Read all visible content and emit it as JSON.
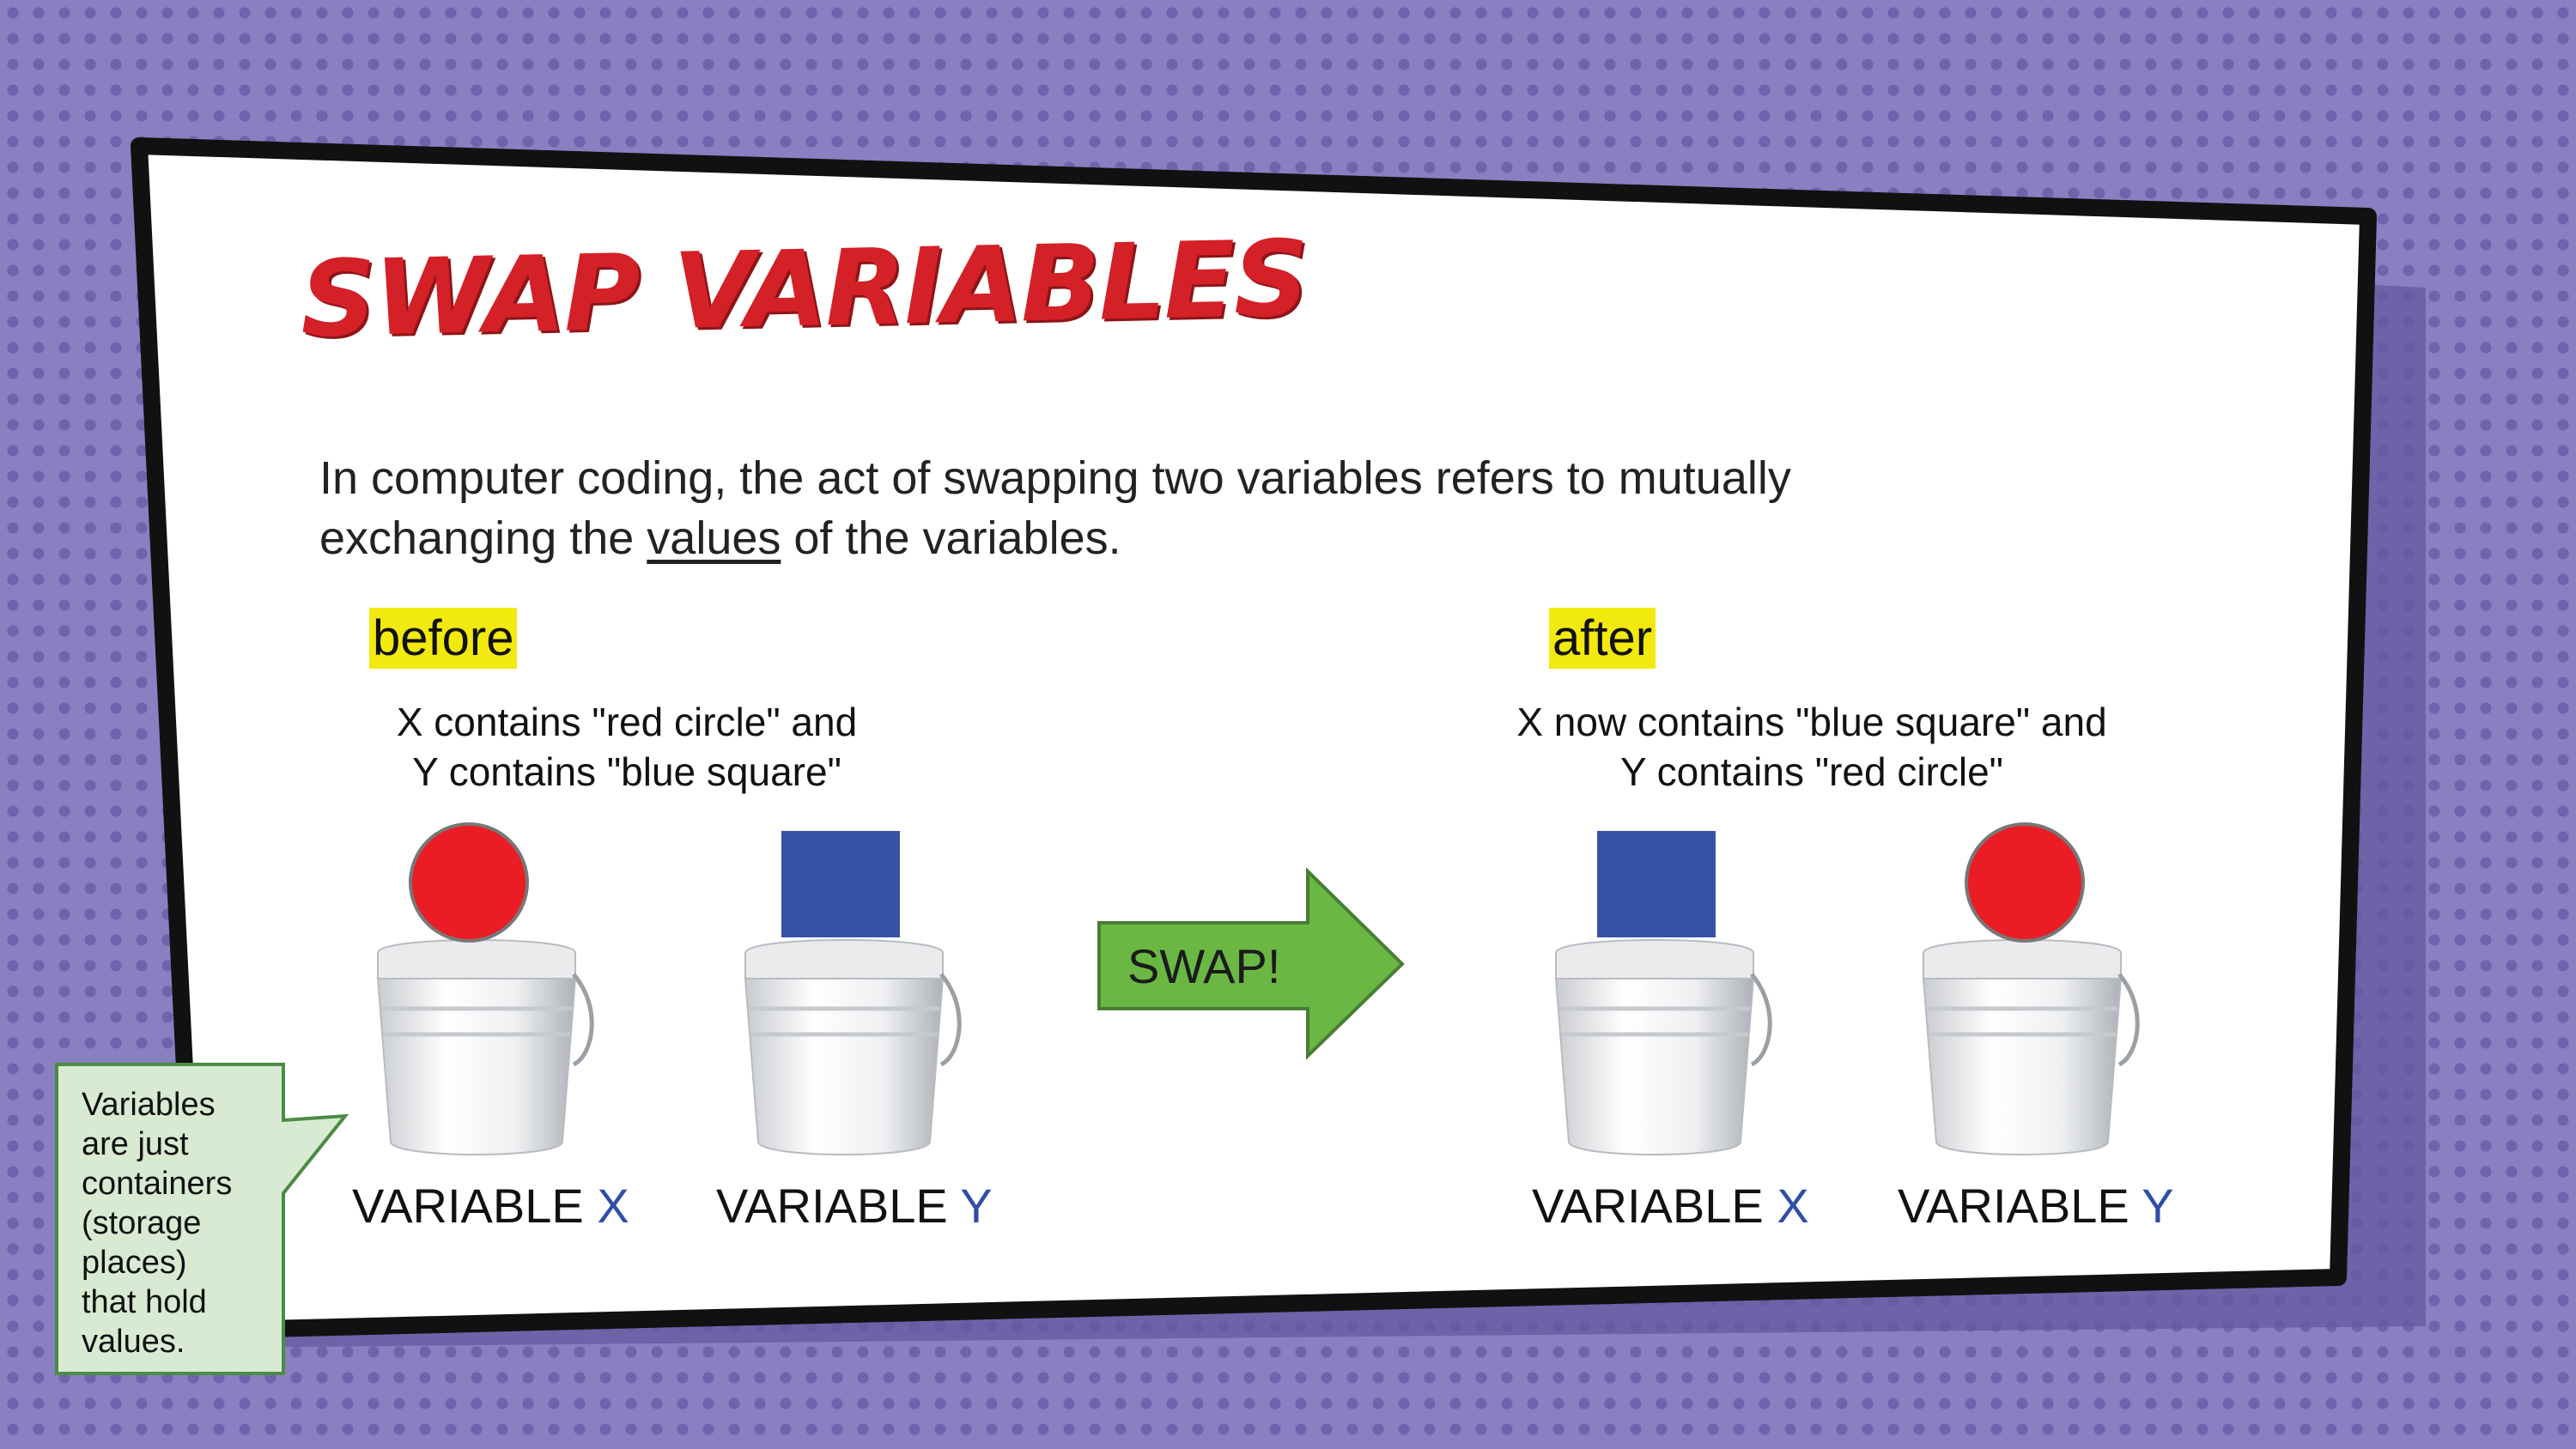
{
  "slide": {
    "title": "SWAP VARIABLES",
    "intro_before": "In computer coding, the act of swapping two variables refers to mutually exchanging the ",
    "intro_emphasis": "values",
    "intro_after": " of the variables."
  },
  "before_panel": {
    "tag": "before",
    "caption_line1": "X contains \"red circle\" and",
    "caption_line2": "Y contains \"blue square\""
  },
  "after_panel": {
    "tag": "after",
    "caption_line1": "X now contains \"blue square\" and",
    "caption_line2": "Y contains \"red circle\""
  },
  "variables": {
    "prefix": "VARIABLE",
    "x_letter": "X",
    "y_letter": "Y"
  },
  "swap_arrow": {
    "label": "SWAP!"
  },
  "note": {
    "text": "Variables are just containers (storage places) that hold values."
  },
  "colors": {
    "red_circle": "#ec1c24",
    "blue_square": "#3653a6",
    "arrow_green": "#6ab843",
    "highlight": "#f2e90f",
    "title_red": "#d42027",
    "note_fill": "#d8ebd2"
  },
  "icons": {
    "bucket": "bucket-icon",
    "red_circle": "red-circle-icon",
    "blue_square": "blue-square-icon",
    "arrow": "right-arrow-icon"
  }
}
